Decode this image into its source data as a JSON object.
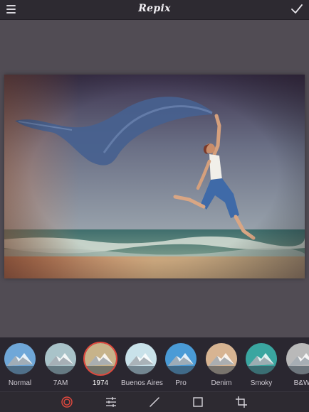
{
  "app": {
    "title": "Repix"
  },
  "filters": [
    {
      "label": "Normal",
      "tint": "#6fa7d8",
      "selected": false
    },
    {
      "label": "7AM",
      "tint": "#a9c3c9",
      "selected": false
    },
    {
      "label": "1974",
      "tint": "#c7b38a",
      "selected": true
    },
    {
      "label": "Buenos Aires",
      "tint": "#c9e2ea",
      "selected": false
    },
    {
      "label": "Pro",
      "tint": "#4a9bd6",
      "selected": false
    },
    {
      "label": "Denim",
      "tint": "#d7b492",
      "selected": false
    },
    {
      "label": "Smoky",
      "tint": "#3aa6a0",
      "selected": false
    },
    {
      "label": "B&W",
      "tint": "#b9b9b9",
      "selected": false
    }
  ],
  "toolbar": {
    "tools": [
      "filters-icon",
      "adjust-icon",
      "brush-icon",
      "frame-icon",
      "crop-icon"
    ]
  },
  "colors": {
    "accent": "#e0493e",
    "topbar": "#2d2a31",
    "canvas": "#514c54"
  }
}
